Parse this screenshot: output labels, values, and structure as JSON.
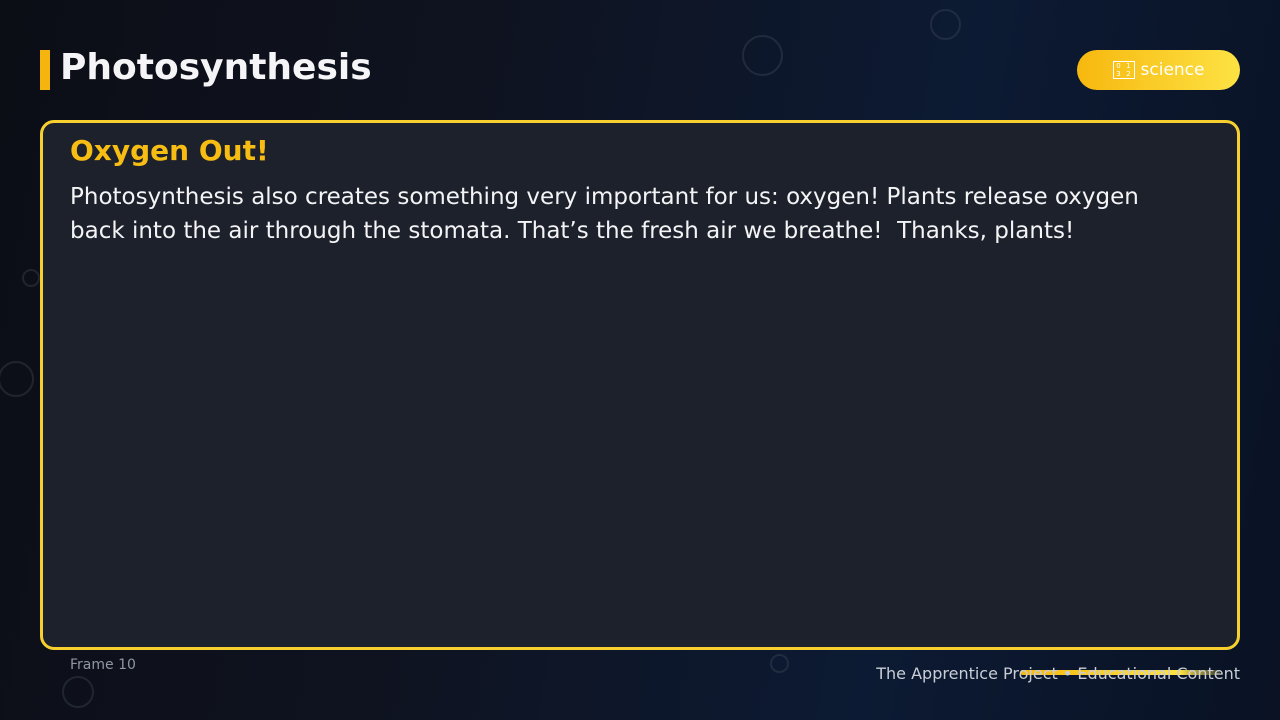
{
  "header": {
    "title": "Photosynthesis",
    "badge": {
      "icon": "input-numbers-icon",
      "icon_glyph": "🔢",
      "label": "science"
    }
  },
  "card": {
    "heading": "Oxygen Out!",
    "body": "Photosynthesis also creates something very important for us: oxygen! Plants release oxygen back into the air through the stomata. That’s the fresh air we breathe!  Thanks, plants!"
  },
  "footer": {
    "frame_label": "Frame 10",
    "credit": "The Apprentice Project • Educational Content"
  },
  "colors": {
    "accent": "#f5b50e",
    "heading": "#f8bd13",
    "card_border": "#f7cf2e",
    "card_background": "#1d212b",
    "badge_gradient_start": "#f7b80f",
    "badge_gradient_end": "#fde243"
  }
}
